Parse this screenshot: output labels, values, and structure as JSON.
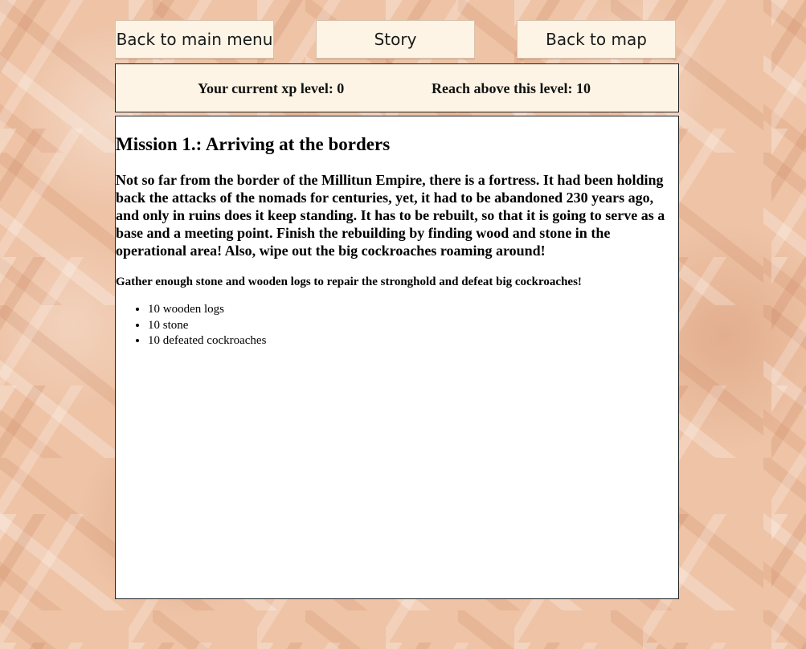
{
  "nav": {
    "main_menu_label": "Back to main menu",
    "story_label": "Story",
    "map_label": "Back to map"
  },
  "xp": {
    "current_text": "Your current xp level: 0",
    "target_text": "Reach above this level: 10"
  },
  "mission": {
    "title": "Mission 1.: Arriving at the borders",
    "story": "Not so far from the border of the Millitun Empire, there is a fortress. It had been holding back the attacks of the nomads for centuries, yet, it had to be abandoned 230 years ago, and only in ruins does it keep standing. It has to be rebuilt, so that it is going to serve as a base and a meeting point. Finish the rebuilding by finding wood and stone in the operational area! Also, wipe out the big cockroaches roaming around!",
    "goal": "Gather enough stone and wooden logs to repair the stronghold and defeat big cockroaches!",
    "objectives": [
      "10 wooden logs",
      "10 stone",
      "10 defeated cockroaches"
    ]
  }
}
